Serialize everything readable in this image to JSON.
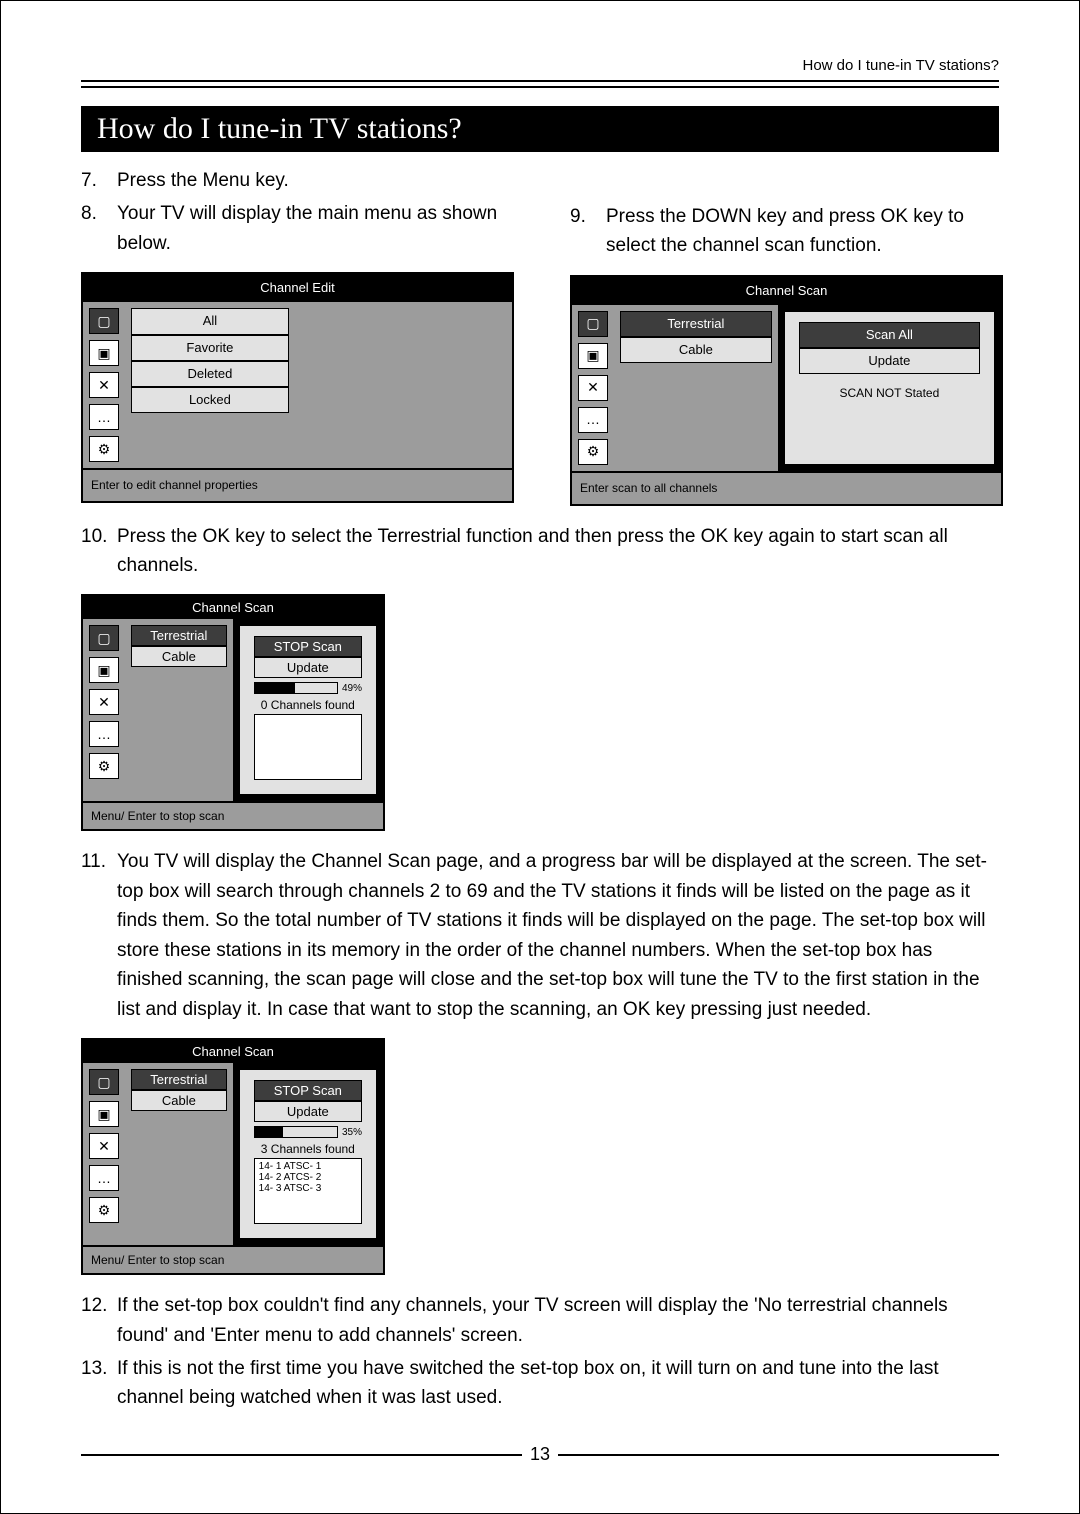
{
  "runningHead": "How do I tune-in TV stations?",
  "sectionTitle": "How do I tune-in TV stations?",
  "pageNumber": "13",
  "steps": {
    "s7": {
      "num": "7.",
      "text": "Press the Menu key."
    },
    "s8": {
      "num": "8.",
      "text": "Your TV will display the main menu as shown  below."
    },
    "s9": {
      "num": "9.",
      "text": "Press the DOWN key and press OK key to select the channel scan function."
    },
    "s10": {
      "num": "10.",
      "text": "Press the OK key to select the Terrestrial function and then press the OK key again to start scan all channels."
    },
    "s11": {
      "num": "11.",
      "text": "You TV will display the Channel Scan page, and a progress bar will be displayed at the screen. The set-top box will search through channels 2 to 69 and the TV stations it finds will be listed on the page as it finds them. So the total number of TV stations it finds will be displayed on the page. The set-top box will store these stations in its memory in the order of the channel numbers. When the set-top box has finished scanning, the scan page will close and the set-top box will tune the TV to the first station in the list and display it. In case that want to stop the scanning, an OK key pressing just needed."
    },
    "s12": {
      "num": "12.",
      "text": "If the set-top box couldn't find any channels, your TV screen will display the 'No terrestrial channels found' and 'Enter menu to add channels' screen."
    },
    "s13": {
      "num": "13.",
      "text": "If this is not the first time you have switched the set-top box on, it will turn on and tune into the last channel being watched when it was last used."
    }
  },
  "osd1": {
    "title": "Channel Edit",
    "items": [
      "All",
      "Favorite",
      "Deleted",
      "Locked"
    ],
    "footer": "Enter to edit channel properties"
  },
  "osd2": {
    "title": "Channel Scan",
    "leftItems": [
      "Terrestrial",
      "Cable"
    ],
    "rightButtons": [
      "Scan All",
      "Update"
    ],
    "status": "SCAN NOT Stated",
    "footer": "Enter scan to all channels"
  },
  "osd3": {
    "title": "Channel Scan",
    "leftItems": [
      "Terrestrial",
      "Cable"
    ],
    "rightButtons": [
      "STOP Scan",
      "Update"
    ],
    "progressPercent": "49%",
    "found": "0 Channels found",
    "footer": "Menu/ Enter to stop scan"
  },
  "osd4": {
    "title": "Channel Scan",
    "leftItems": [
      "Terrestrial",
      "Cable"
    ],
    "rightButtons": [
      "STOP Scan",
      "Update"
    ],
    "progressPercent": "35%",
    "found": "3 Channels found",
    "channels": [
      "14- 1 ATSC- 1",
      "14- 2 ATCS- 2",
      "14- 3 ATSC- 3"
    ],
    "footer": "Menu/ Enter to stop scan"
  },
  "iconGlyphs": {
    "tv": "▢",
    "sat": "▣",
    "tools": "✕",
    "chat": "…",
    "gears": "⚙"
  }
}
